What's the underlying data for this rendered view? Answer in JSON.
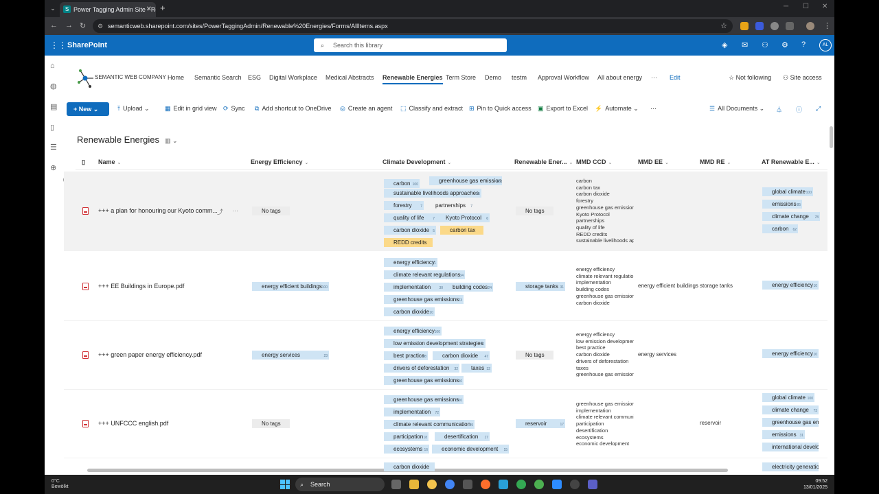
{
  "browser": {
    "tab_title": "Power Tagging Admin Site - Re",
    "url": "semanticweb.sharepoint.com/sites/PowerTaggingAdmin/Renewable%20Energies/Forms/AllItems.aspx"
  },
  "suite": {
    "app_name": "SharePoint",
    "search_placeholder": "Search this library",
    "user_initials": "AL"
  },
  "site": {
    "logo_text": "SEMANTIC WEB COMPANY",
    "nav": [
      "Home",
      "Semantic Search",
      "ESG",
      "Digital Workplace",
      "Medical Abstracts",
      "Renewable Energies",
      "Term Store",
      "Demo",
      "testm",
      "Approval Workflow",
      "All about energy",
      "···",
      "Edit"
    ],
    "active_nav": "Renewable Energies",
    "follow_label": "Not following",
    "access_label": "Site access"
  },
  "commands": {
    "new": "New",
    "upload": "Upload",
    "grid": "Edit in grid view",
    "sync": "Sync",
    "shortcut": "Add shortcut to OneDrive",
    "agent": "Create an agent",
    "classify": "Classify and extract",
    "pin": "Pin to Quick access",
    "export": "Export to Excel",
    "automate": "Automate",
    "more": "···",
    "view": "All Documents"
  },
  "library": {
    "title": "Renewable Energies",
    "columns": [
      "Name",
      "Energy Efficiency",
      "Climate Development",
      "Renewable Ener...",
      "MMD CCD",
      "MMD EE",
      "MMD RE",
      "AT Renewable E..."
    ]
  },
  "rows": [
    {
      "name": "+++ a plan for honouring our Kyoto comm...",
      "ee": "No tags",
      "re": "No tags",
      "cd": [
        {
          "t": "carbon",
          "n": "100"
        },
        {
          "t": "greenhouse gas emissions",
          "n": "65"
        },
        {
          "t": "sustainable livelihoods approaches",
          "n": "15"
        },
        {
          "t": "forestry",
          "n": "7"
        },
        {
          "t": "partnerships",
          "n": "7"
        },
        {
          "t": "quality of life",
          "n": "7"
        },
        {
          "t": "Kyoto Protocol",
          "n": "6"
        },
        {
          "t": "carbon dioxide",
          "n": "5"
        },
        {
          "t": "carbon tax",
          "n": ""
        },
        {
          "t": "REDD credits",
          "n": ""
        }
      ],
      "ccd": [
        "carbon",
        "carbon tax",
        "carbon dioxide",
        "forestry",
        "greenhouse gas emissions",
        "Kyoto Protocol",
        "partnerships",
        "quality of life",
        "REDD credits",
        "sustainable livelihoods ap"
      ],
      "mmd_ee": "",
      "mmd_re": "",
      "at": [
        {
          "t": "global climate",
          "n": "100"
        },
        {
          "t": "emissions",
          "n": "85"
        },
        {
          "t": "climate change",
          "n": "78"
        },
        {
          "t": "carbon",
          "n": "62"
        }
      ]
    },
    {
      "name": "+++ EE Buildings in Europe.pdf",
      "ee": "energy efficient buildings",
      "ee_n": "100",
      "re": "storage tanks",
      "re_n": "31",
      "cd": [
        {
          "t": "energy efficiency",
          "n": "61"
        },
        {
          "t": "climate relevant regulations",
          "n": "34"
        },
        {
          "t": "implementation",
          "n": "30"
        },
        {
          "t": "building codes",
          "n": "24"
        },
        {
          "t": "greenhouse gas emissions",
          "n": "23"
        },
        {
          "t": "carbon dioxide",
          "n": "20"
        }
      ],
      "ccd": [
        "energy efficiency",
        "climate relevant regulatio",
        "implementation",
        "building codes",
        "greenhouse gas emissions",
        "carbon dioxide"
      ],
      "mmd_ee": "energy efficient buildings",
      "mmd_re": "storage tanks",
      "at": [
        {
          "t": "energy efficiency",
          "n": "10"
        }
      ]
    },
    {
      "name": "+++ green paper energy efficiency.pdf",
      "ee": "energy services",
      "ee_n": "23",
      "re": "No tags",
      "cd": [
        {
          "t": "energy efficiency",
          "n": "100"
        },
        {
          "t": "low emission development strategies",
          "n": "72"
        },
        {
          "t": "best practice",
          "n": "48"
        },
        {
          "t": "carbon dioxide",
          "n": "47"
        },
        {
          "t": "drivers of deforestation",
          "n": "32"
        },
        {
          "t": "taxes",
          "n": "32"
        },
        {
          "t": "greenhouse gas emissions",
          "n": "30"
        }
      ],
      "ccd": [
        "energy efficiency",
        "low emission developmen",
        "best practice",
        "carbon dioxide",
        "drivers of deforestation",
        "taxes",
        "greenhouse gas emissions"
      ],
      "mmd_ee": "energy services",
      "mmd_re": "",
      "at": [
        {
          "t": "energy efficiency",
          "n": "10"
        }
      ]
    },
    {
      "name": "+++ UNFCCC english.pdf",
      "ee": "No tags",
      "re": "reservoir",
      "re_n": "17",
      "cd": [
        {
          "t": "greenhouse gas emissions",
          "n": "100"
        },
        {
          "t": "implementation",
          "n": "72"
        },
        {
          "t": "climate relevant communication",
          "n": "29"
        },
        {
          "t": "participation",
          "n": "18"
        },
        {
          "t": "desertification",
          "n": "17"
        },
        {
          "t": "ecosystems",
          "n": "16"
        },
        {
          "t": "economic development",
          "n": "15"
        }
      ],
      "ccd": [
        "greenhouse gas emissions",
        "implementation",
        "climate relevant communi",
        "participation",
        "desertification",
        "ecosystems",
        "economic development"
      ],
      "mmd_ee": "",
      "mmd_re": "reservoir",
      "at": [
        {
          "t": "global climate",
          "n": "100"
        },
        {
          "t": "climate change",
          "n": "73"
        },
        {
          "t": "greenhouse gas emi",
          "n": ""
        },
        {
          "t": "emissions",
          "n": "31"
        },
        {
          "t": "international develo",
          "n": ""
        }
      ]
    },
    {
      "name": "",
      "cd": [
        {
          "t": "carbon dioxide",
          "n": ""
        }
      ],
      "at": [
        {
          "t": "electricity generation",
          "n": ""
        }
      ]
    }
  ],
  "taskbar": {
    "temp": "0°C",
    "weather": "Bewölkt",
    "search": "Search",
    "time": "09:52",
    "date": "13/01/2025"
  },
  "colors": {
    "suite": "#0f6cbd",
    "tag": "#cfe4f4",
    "tag_highlight": "#fbd989"
  }
}
